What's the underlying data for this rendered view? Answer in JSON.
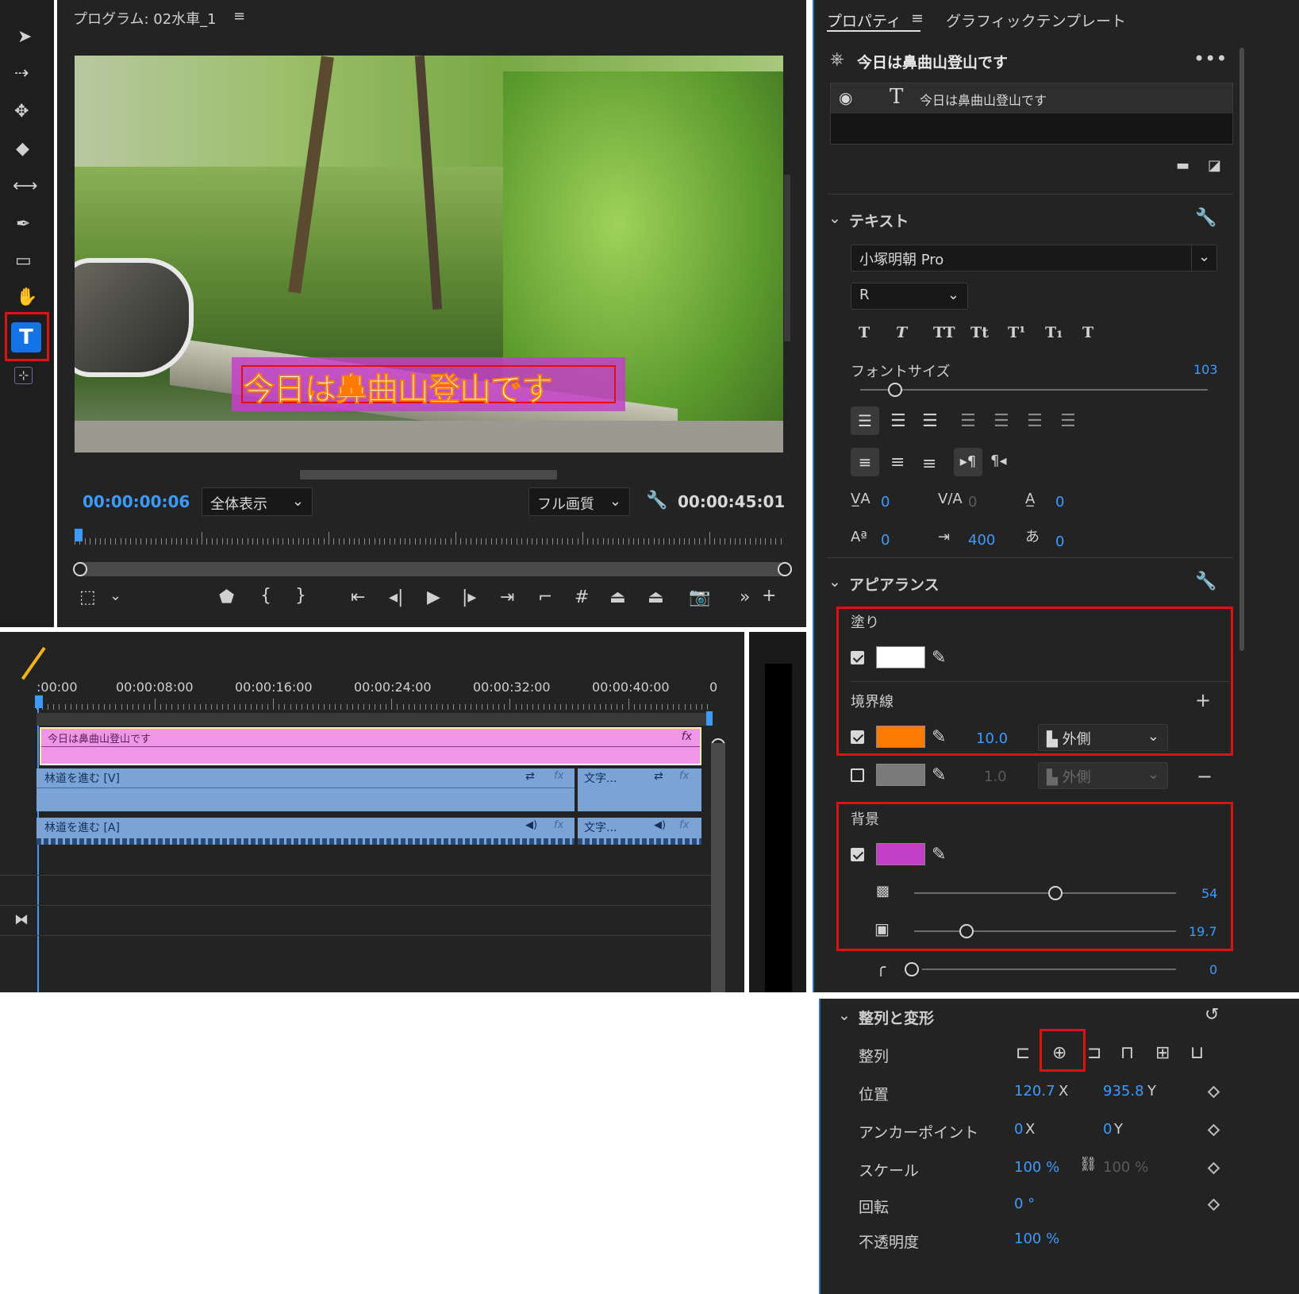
{
  "program_monitor": {
    "title": "プログラム: 02水車_1",
    "timecode_current": "00:00:00:06",
    "timecode_duration": "00:00:45:01",
    "zoom_select": "全体表示",
    "quality_select": "フル画質",
    "caption_text": "今日は鼻曲山登山です"
  },
  "properties": {
    "tab_properties": "プロパティ",
    "tab_graphics": "グラフィックテンプレート",
    "layer_group_title": "今日は鼻曲山登山です",
    "layer_text_name": "今日は鼻曲山登山です",
    "text_section": {
      "header": "テキスト",
      "font_family": "小塚明朝 Pro",
      "font_style": "R",
      "font_size_label": "フォントサイズ",
      "font_size_value": "103",
      "font_size_fraction": 0.1,
      "kerning": "0",
      "tracking": "0",
      "leading": "0",
      "baseline": "0",
      "tab_width": "400",
      "tsume": "0",
      "style_buttons": [
        "T",
        "T",
        "TT",
        "Tt",
        "T¹",
        "T₁",
        "T"
      ]
    },
    "appearance": {
      "header": "アピアランス",
      "fill_label": "塗り",
      "fill_color": "#ffffff",
      "stroke_label": "境界線",
      "stroke_color": "#ff7a00",
      "stroke_width": "10.0",
      "stroke_position": "外側",
      "stroke2_color": "#7a7a7a",
      "stroke2_width": "1.0",
      "stroke2_position": "外側",
      "background_label": "背景",
      "background_color": "#c43fc8",
      "bg_opacity_value": "54",
      "bg_opacity_fraction": 0.54,
      "bg_size_value": "19.7",
      "bg_size_fraction": 0.2,
      "corner_value": "0"
    }
  },
  "align_transform": {
    "header": "整列と変形",
    "align_label": "整列",
    "position_label": "位置",
    "position_x": "120.7",
    "position_y": "935.8",
    "anchor_label": "アンカーポイント",
    "anchor_x": "0",
    "anchor_y": "0",
    "scale_label": "スケール",
    "scale_value": "100 %",
    "scale_value2": "100 %",
    "rotation_label": "回転",
    "rotation_value": "0 °",
    "opacity_label": "不透明度",
    "opacity_value": "100 %",
    "x_suffix": "X",
    "y_suffix": "Y"
  },
  "timeline": {
    "ruler_labels": [
      ":00:00",
      "00:00:08:00",
      "00:00:16:00",
      "00:00:24:00",
      "00:00:32:00",
      "00:00:40:00",
      "0"
    ],
    "clip_graphic": "今日は鼻曲山登山です",
    "clip_video": "林道を進む [V]",
    "clip_video2": "文字...",
    "clip_audio": "林道を進む [A]",
    "clip_audio2": "文字..."
  },
  "colors": {
    "panel_bg": "#232323",
    "accent_blue": "#3d9bff",
    "highlight_red": "#e01010",
    "graphic_clip": "#f096e8",
    "video_clip": "#7aa3d6"
  }
}
